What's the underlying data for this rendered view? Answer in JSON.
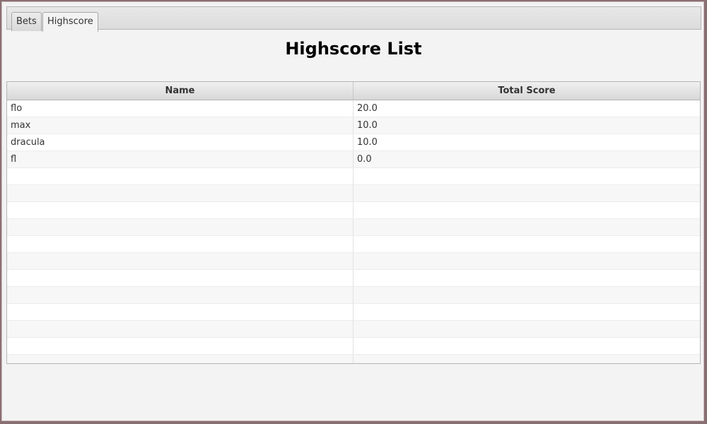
{
  "tabs": [
    {
      "label": "Bets"
    },
    {
      "label": "Highscore"
    }
  ],
  "active_tab": "Highscore",
  "main": {
    "title": "Highscore List"
  },
  "table": {
    "columns": [
      "Name",
      "Total Score"
    ],
    "rows": [
      {
        "name": "flo",
        "score": "20.0"
      },
      {
        "name": "max",
        "score": "10.0"
      },
      {
        "name": "dracula",
        "score": "10.0"
      },
      {
        "name": "fl",
        "score": "0.0"
      }
    ],
    "empty_rows": 12
  },
  "colors": {
    "window_bg": "#f3f3f3",
    "frame": "#8a6f72"
  }
}
